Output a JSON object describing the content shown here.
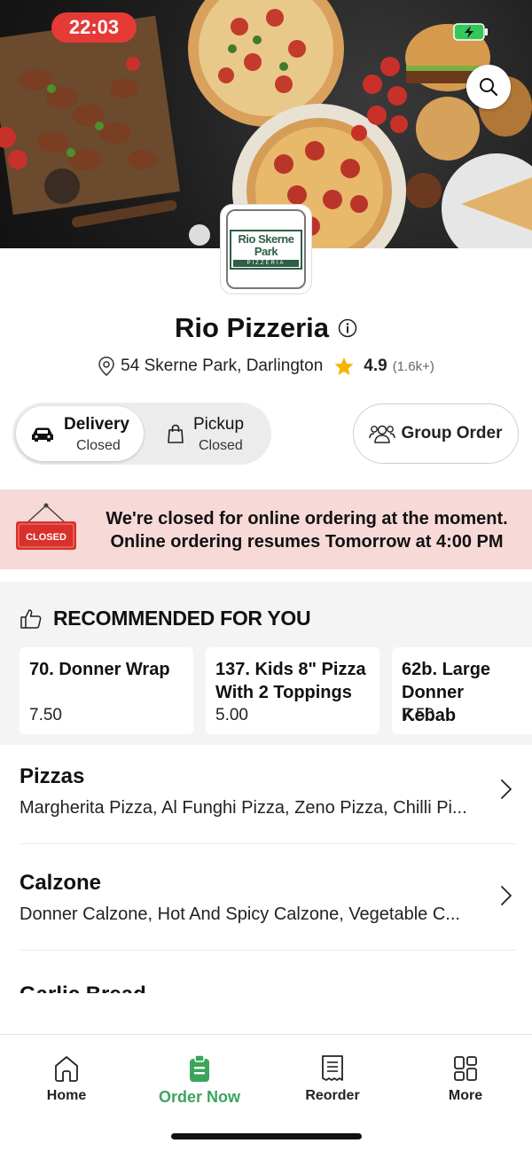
{
  "status_bar": {
    "time": "22:03"
  },
  "restaurant": {
    "logo_text": "Rio Skerne Park",
    "logo_subtext": "PIZZERIA",
    "name": "Rio Pizzeria",
    "address": "54 Skerne Park, Darlington",
    "rating": "4.9",
    "rating_count": "(1.6k+)"
  },
  "order_mode": {
    "delivery_label": "Delivery",
    "delivery_status": "Closed",
    "pickup_label": "Pickup",
    "pickup_status": "Closed",
    "selected": "Delivery"
  },
  "group_order_label": "Group Order",
  "closed_banner": {
    "sign_text": "CLOSED",
    "line1": "We're closed for online ordering at the moment.",
    "line2": "Online ordering resumes Tomorrow at 4:00 PM"
  },
  "recommended": {
    "title": "RECOMMENDED FOR YOU",
    "items": [
      {
        "name": "70. Donner Wrap",
        "price": "7.50"
      },
      {
        "name": "137. Kids 8\" Pizza With 2 Toppings",
        "price": "5.00"
      },
      {
        "name": "62b. Large Donner Kebab",
        "price": "7.50"
      }
    ]
  },
  "categories": [
    {
      "title": "Pizzas",
      "items": "Margherita Pizza, Al Funghi Pizza, Zeno Pizza, Chilli Pi..."
    },
    {
      "title": "Calzone",
      "items": "Donner Calzone, Hot And Spicy Calzone, Vegetable C..."
    },
    {
      "title": "Garlic Bread"
    }
  ],
  "nav": {
    "items": [
      {
        "label": "Home",
        "icon": "home-icon"
      },
      {
        "label": "Order Now",
        "icon": "order-icon",
        "active": true
      },
      {
        "label": "Reorder",
        "icon": "receipt-icon"
      },
      {
        "label": "More",
        "icon": "grid-icon"
      }
    ]
  },
  "colors": {
    "accent": "#3ca55c",
    "closed_red": "#e53a36",
    "banner_bg": "#f7d9d8",
    "star": "#f5b400"
  }
}
